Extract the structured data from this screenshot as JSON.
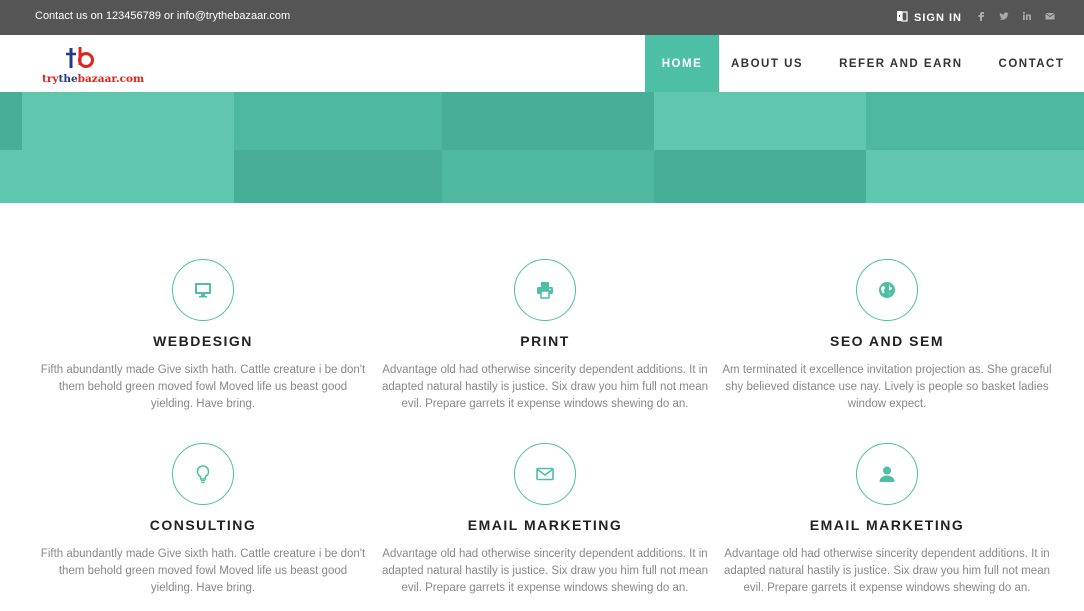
{
  "topbar": {
    "contact_text": "Contact us on 123456789 or info@trythebazaar.com",
    "signin_label": "SIGN IN",
    "socials": [
      "facebook-icon",
      "twitter-icon",
      "linkedin-icon",
      "envelope-icon"
    ]
  },
  "header": {
    "logo": {
      "mark": "tb",
      "text_part1": "try",
      "text_part2": "the",
      "text_part3": "bazaar.com"
    },
    "nav": [
      {
        "label": "HOME",
        "active": true
      },
      {
        "label": "ABOUT US",
        "active": false
      },
      {
        "label": "REFER AND EARN",
        "active": false
      },
      {
        "label": "CONTACT",
        "active": false
      }
    ]
  },
  "colors": {
    "accent": "#4dbfa5",
    "topbar": "#555555",
    "heading": "#222222",
    "body_text": "#888888"
  },
  "services": [
    {
      "icon": "monitor-icon",
      "title": "WEBDESIGN",
      "description": "Fifth abundantly made Give sixth hath. Cattle creature i be don't them behold green moved fowl Moved life us beast good yielding. Have bring."
    },
    {
      "icon": "printer-icon",
      "title": "PRINT",
      "description": "Advantage old had otherwise sincerity dependent additions. It in adapted natural hastily is justice. Six draw you him full not mean evil. Prepare garrets it expense windows shewing do an."
    },
    {
      "icon": "globe-icon",
      "title": "SEO AND SEM",
      "description": "Am terminated it excellence invitation projection as. She graceful shy believed distance use nay. Lively is people so basket ladies window expect."
    },
    {
      "icon": "lightbulb-icon",
      "title": "CONSULTING",
      "description": "Fifth abundantly made Give sixth hath. Cattle creature i be don't them behold green moved fowl Moved life us beast good yielding. Have bring."
    },
    {
      "icon": "envelope-icon",
      "title": "EMAIL MARKETING",
      "description": "Advantage old had otherwise sincerity dependent additions. It in adapted natural hastily is justice. Six draw you him full not mean evil. Prepare garrets it expense windows shewing do an."
    },
    {
      "icon": "user-icon",
      "title": "EMAIL MARKETING",
      "description": "Advantage old had otherwise sincerity dependent additions. It in adapted natural hastily is justice. Six draw you him full not mean evil. Prepare garrets it expense windows shewing do an."
    }
  ]
}
